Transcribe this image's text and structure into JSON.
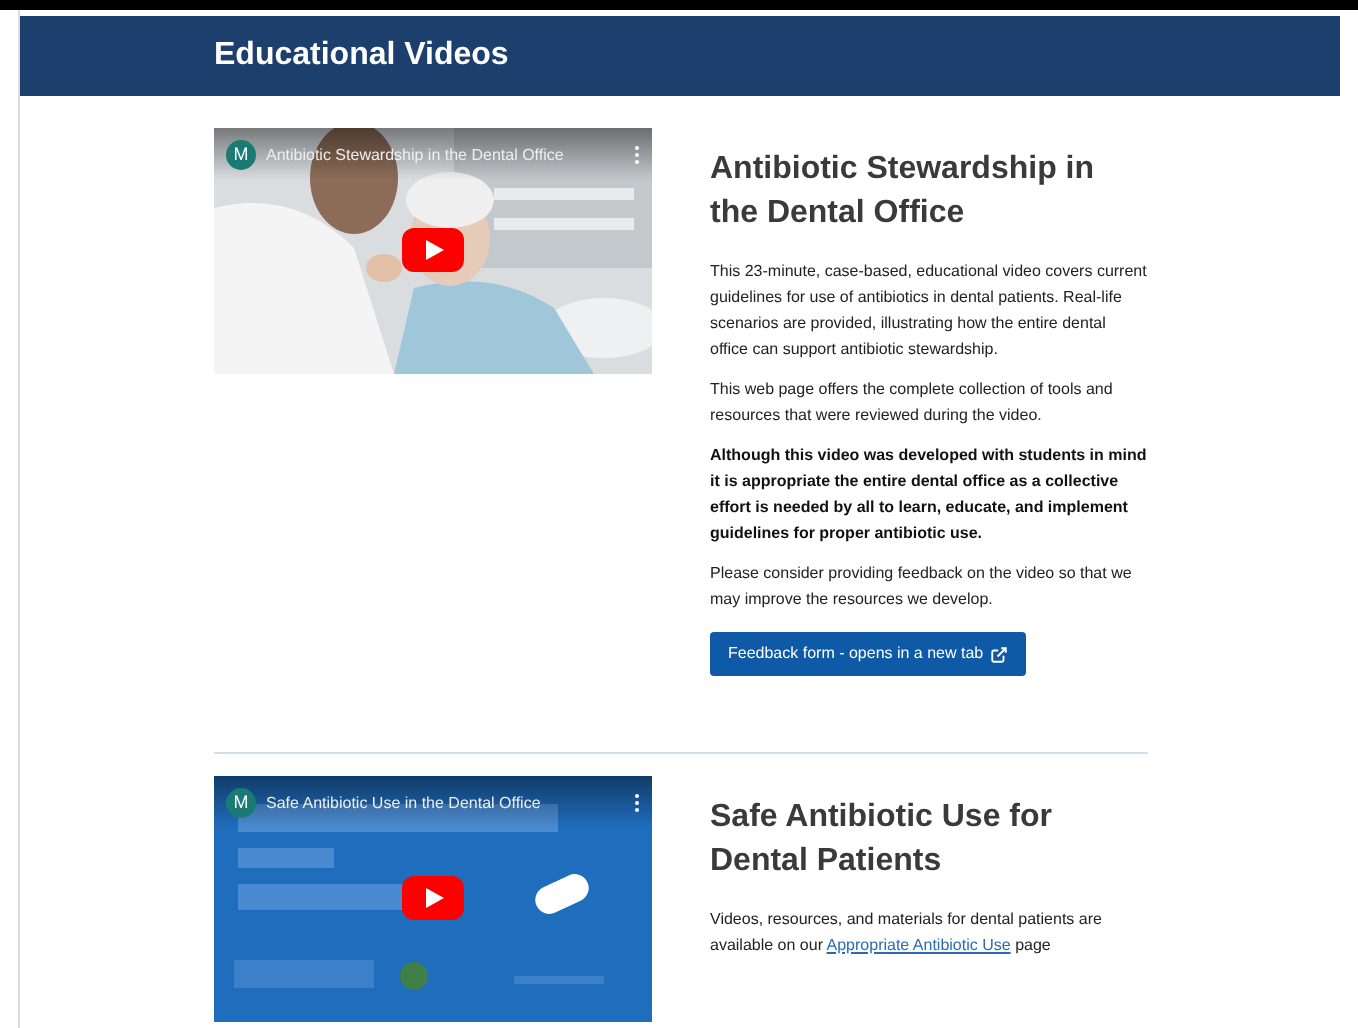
{
  "header": {
    "title": "Educational Videos"
  },
  "videos": [
    {
      "player": {
        "channel_initial": "M",
        "title": "Antibiotic Stewardship in the Dental Office"
      },
      "heading": "Antibiotic Stewardship in the Dental Office",
      "paragraphs": [
        {
          "kind": "plain",
          "text": "This 23-minute, case-based, educational video covers current guidelines for use of antibiotics in dental patients. Real-life scenarios are provided, illustrating how the entire dental office can support antibiotic stewardship."
        },
        {
          "kind": "plain",
          "text": "This web page offers the complete collection of tools and resources that were reviewed during the video."
        },
        {
          "kind": "bold",
          "text": "Although this video was developed with students in mind it is appropriate the entire dental office as a collective effort is needed by all to learn, educate, and implement guidelines for proper antibiotic use."
        },
        {
          "kind": "plain",
          "text": "Please consider providing feedback on the video so that we may improve the resources we develop."
        }
      ],
      "button": {
        "label": "Feedback form - opens in a new tab"
      }
    },
    {
      "player": {
        "channel_initial": "M",
        "title": "Safe Antibiotic Use in the Dental Office",
        "kind": "slide"
      },
      "heading": "Safe Antibiotic Use for Dental Patients",
      "paragraphs": [
        {
          "kind": "link",
          "before": "Videos, resources, and materials for dental patients are available on our",
          "link": "Appropriate Antibiotic Use",
          "after": "page"
        }
      ]
    }
  ]
}
